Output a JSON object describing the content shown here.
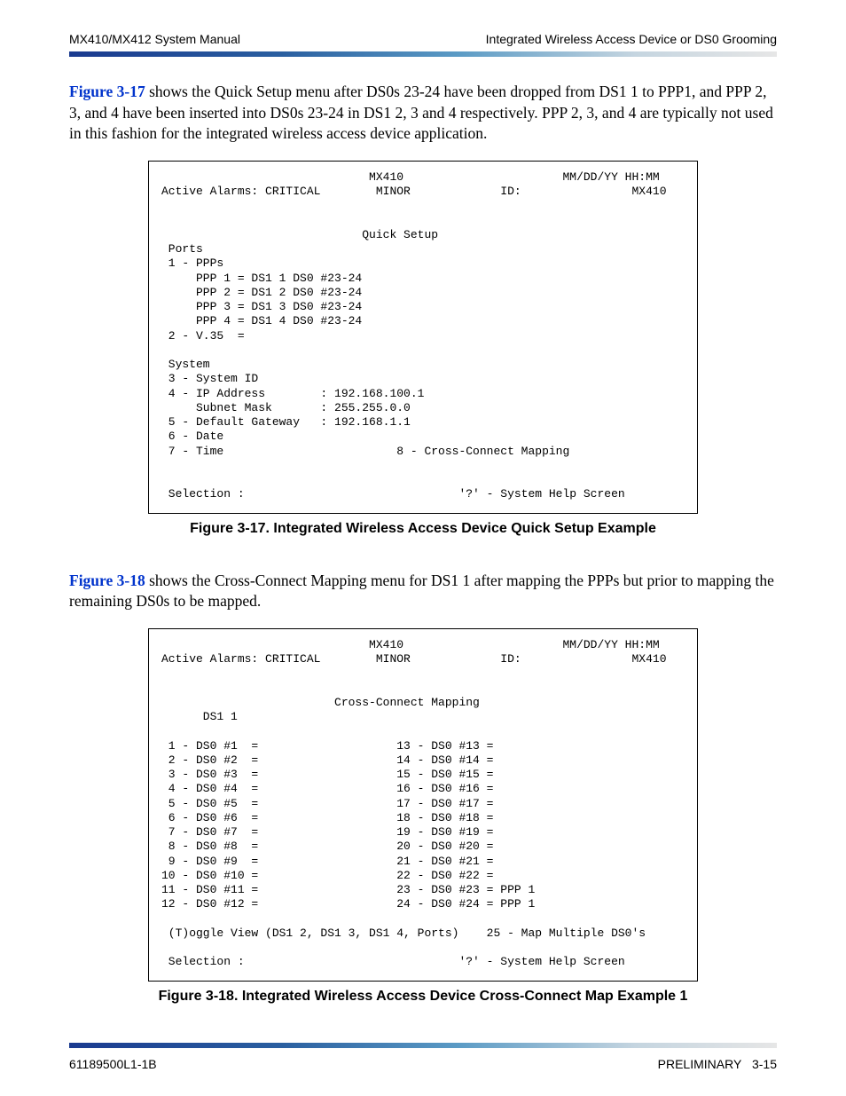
{
  "header": {
    "left": "MX410/MX412 System Manual",
    "right": "Integrated Wireless Access Device or DS0 Grooming"
  },
  "para1": {
    "ref": "Figure 3-17",
    "text": " shows the Quick Setup menu after DS0s 23-24 have been dropped from DS1 1 to PPP1, and PPP 2, 3, and 4 have been inserted into DS0s 23-24 in DS1 2, 3 and 4 respectively. PPP 2, 3, and 4 are typically not used in this fashion for the integrated wireless access device application."
  },
  "terminal1": "                              MX410                       MM/DD/YY HH:MM\nActive Alarms: CRITICAL        MINOR             ID:                MX410\n\n\n                             Quick Setup\n Ports\n 1 - PPPs\n     PPP 1 = DS1 1 DS0 #23-24\n     PPP 2 = DS1 2 DS0 #23-24\n     PPP 3 = DS1 3 DS0 #23-24\n     PPP 4 = DS1 4 DS0 #23-24\n 2 - V.35  =\n\n System\n 3 - System ID\n 4 - IP Address        : 192.168.100.1\n     Subnet Mask       : 255.255.0.0\n 5 - Default Gateway   : 192.168.1.1\n 6 - Date\n 7 - Time                         8 - Cross-Connect Mapping\n\n\n Selection :                               '?' - System Help Screen\n",
  "caption1": "Figure 3-17.  Integrated Wireless Access Device Quick Setup Example",
  "para2": {
    "ref": "Figure 3-18",
    "text": " shows the Cross-Connect Mapping menu for DS1 1 after mapping the PPPs but prior to mapping the remaining DS0s to be mapped."
  },
  "terminal2": "                              MX410                       MM/DD/YY HH:MM\nActive Alarms: CRITICAL        MINOR             ID:                MX410\n\n\n                         Cross-Connect Mapping\n      DS1 1\n\n 1 - DS0 #1  =                    13 - DS0 #13 =\n 2 - DS0 #2  =                    14 - DS0 #14 =\n 3 - DS0 #3  =                    15 - DS0 #15 =\n 4 - DS0 #4  =                    16 - DS0 #16 =\n 5 - DS0 #5  =                    17 - DS0 #17 =\n 6 - DS0 #6  =                    18 - DS0 #18 =\n 7 - DS0 #7  =                    19 - DS0 #19 =\n 8 - DS0 #8  =                    20 - DS0 #20 =\n 9 - DS0 #9  =                    21 - DS0 #21 =\n10 - DS0 #10 =                    22 - DS0 #22 =\n11 - DS0 #11 =                    23 - DS0 #23 = PPP 1\n12 - DS0 #12 =                    24 - DS0 #24 = PPP 1\n\n (T)oggle View (DS1 2, DS1 3, DS1 4, Ports)    25 - Map Multiple DS0's\n\n Selection :                               '?' - System Help Screen\n",
  "caption2": "Figure 3-18.  Integrated Wireless Access Device Cross-Connect Map Example 1",
  "footer": {
    "left": "61189500L1-1B",
    "right_label": "PRELIMINARY",
    "right_page": "3-15"
  }
}
